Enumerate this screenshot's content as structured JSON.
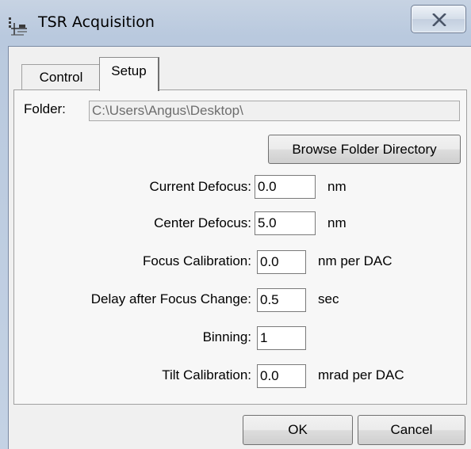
{
  "window": {
    "title": "TSR Acquisition",
    "icon": "tsr-app-icon"
  },
  "tabs": [
    {
      "label": "Control",
      "selected": false
    },
    {
      "label": "Setup",
      "selected": true
    }
  ],
  "setup": {
    "folder_label": "Folder:",
    "folder_value": "C:\\Users\\Angus\\Desktop\\",
    "browse_button": "Browse Folder Directory",
    "fields": [
      {
        "label": "Current Defocus:",
        "value": "0.0",
        "unit": "nm"
      },
      {
        "label": "Center Defocus:",
        "value": "5.0",
        "unit": "nm"
      },
      {
        "label": "Focus Calibration:",
        "value": "0.0",
        "unit": "nm per DAC"
      },
      {
        "label": "Delay after Focus Change:",
        "value": "0.5",
        "unit": "sec"
      },
      {
        "label": "Binning:",
        "value": "1",
        "unit": ""
      },
      {
        "label": "Tilt Calibration:",
        "value": "0.0",
        "unit": "mrad per DAC"
      }
    ]
  },
  "buttons": {
    "ok": "OK",
    "cancel": "Cancel"
  }
}
